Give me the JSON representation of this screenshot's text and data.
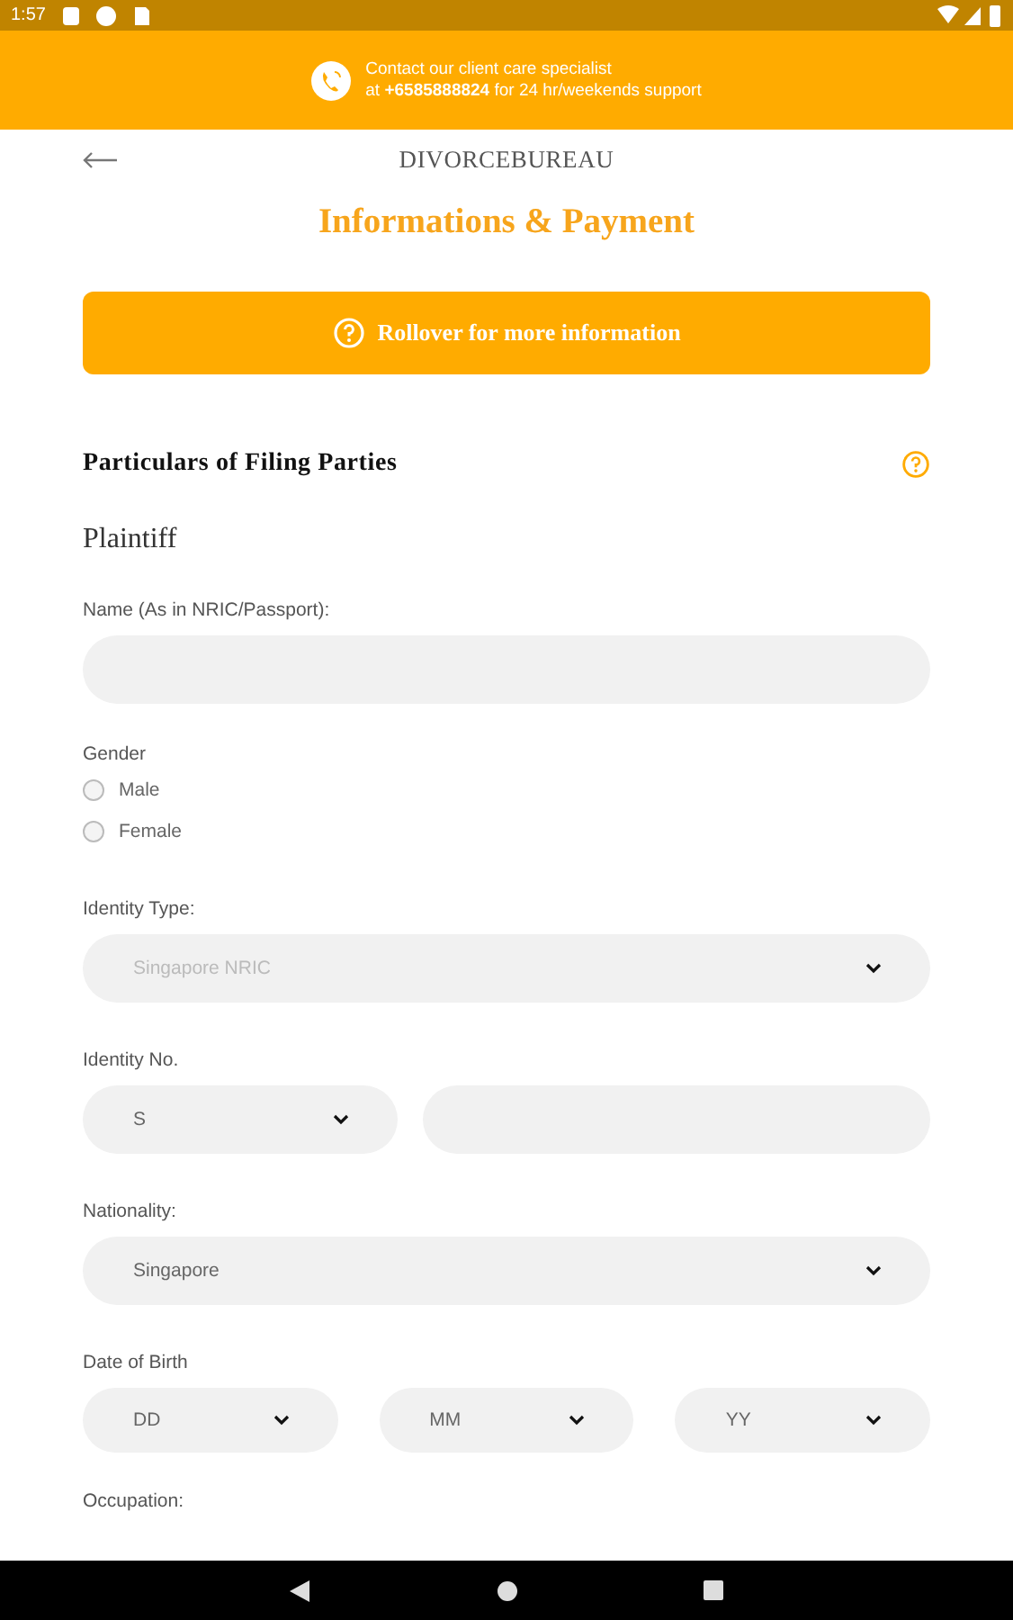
{
  "status_bar": {
    "time": "1:57"
  },
  "contact_banner": {
    "line1": "Contact our client care specialist",
    "line2": "at **+6585888824** for 24 hr/weekends support"
  },
  "header": {
    "logo": "DIVORCEBUREAU",
    "title": "Informations & Payment"
  },
  "info_button": {
    "label": "Rollover for more information"
  },
  "section": {
    "title": "Particulars of Filing Parties",
    "subtitle": "Plaintiff"
  },
  "fields": [
    {
      "kind": "text",
      "label": "Name (As in NRIC/Passport):"
    },
    {
      "kind": "radio",
      "label": "Gender",
      "options": [
        {
          "label": "Male",
          "selected": false
        },
        {
          "label": "Female",
          "selected": false
        }
      ]
    },
    {
      "kind": "select",
      "label": "Identity Type:",
      "value": "Singapore NRIC",
      "muted": true
    },
    {
      "kind": "id",
      "label": "Identity No.",
      "prefix": "S"
    },
    {
      "kind": "select",
      "label": "Nationality:",
      "value": "Singapore",
      "muted": false
    },
    {
      "kind": "date",
      "label": "Date of Birth",
      "parts": [
        "DD",
        "MM",
        "YY"
      ]
    },
    {
      "kind": "cut",
      "label": "Occupation:"
    }
  ]
}
